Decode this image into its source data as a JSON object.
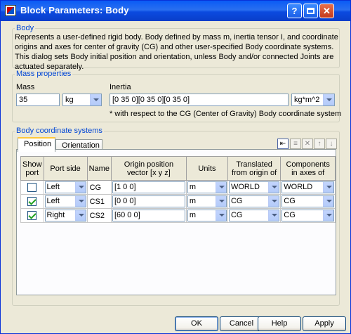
{
  "window": {
    "title": "Block Parameters: Body",
    "help_glyph": "?",
    "max_glyph": "□",
    "close_glyph": "✕"
  },
  "body_group": {
    "legend": "Body",
    "description": "Represents a user-defined rigid body. Body defined by mass m, inertia tensor I, and coordinate origins and axes for center of gravity (CG) and other user-specified Body coordinate systems. This dialog sets Body initial position and orientation, unless Body and/or connected Joints are actuated separately."
  },
  "mass_group": {
    "legend": "Mass properties",
    "mass_label": "Mass",
    "mass_value": "35",
    "mass_unit": "kg",
    "inertia_label": "Inertia",
    "inertia_value": "[0 35 0][0 35 0][0 35 0]",
    "inertia_unit": "kg*m^2",
    "note": "* with respect to the CG (Center of Gravity) Body coordinate system"
  },
  "coord_group": {
    "legend": "Body coordinate systems",
    "tabs": [
      "Position",
      "Orientation"
    ],
    "columns": [
      "Show port",
      "Port side",
      "Name",
      "Origin position vector [x y z]",
      "Units",
      "Translated from origin of",
      "Components in axes of"
    ],
    "rows": [
      {
        "show_port": false,
        "port_side": "Left",
        "name": "CG",
        "origin": "[1 0 0]",
        "units": "m",
        "translated": "WORLD",
        "components": "WORLD"
      },
      {
        "show_port": true,
        "port_side": "Left",
        "name": "CS1",
        "origin": "[0 0 0]",
        "units": "m",
        "translated": "CG",
        "components": "CG"
      },
      {
        "show_port": true,
        "port_side": "Right",
        "name": "CS2",
        "origin": "[60 0 0]",
        "units": "m",
        "translated": "CG",
        "components": "CG"
      }
    ],
    "toolbar_icons": [
      "add-row-icon",
      "duplicate-row-icon",
      "delete-row-icon",
      "move-up-icon",
      "move-down-icon"
    ],
    "toolbar_glyphs": [
      "⇤",
      "≡",
      "✕",
      "↑",
      "↓"
    ]
  },
  "buttons": {
    "ok": "OK",
    "cancel": "Cancel",
    "help": "Help",
    "apply": "Apply"
  }
}
